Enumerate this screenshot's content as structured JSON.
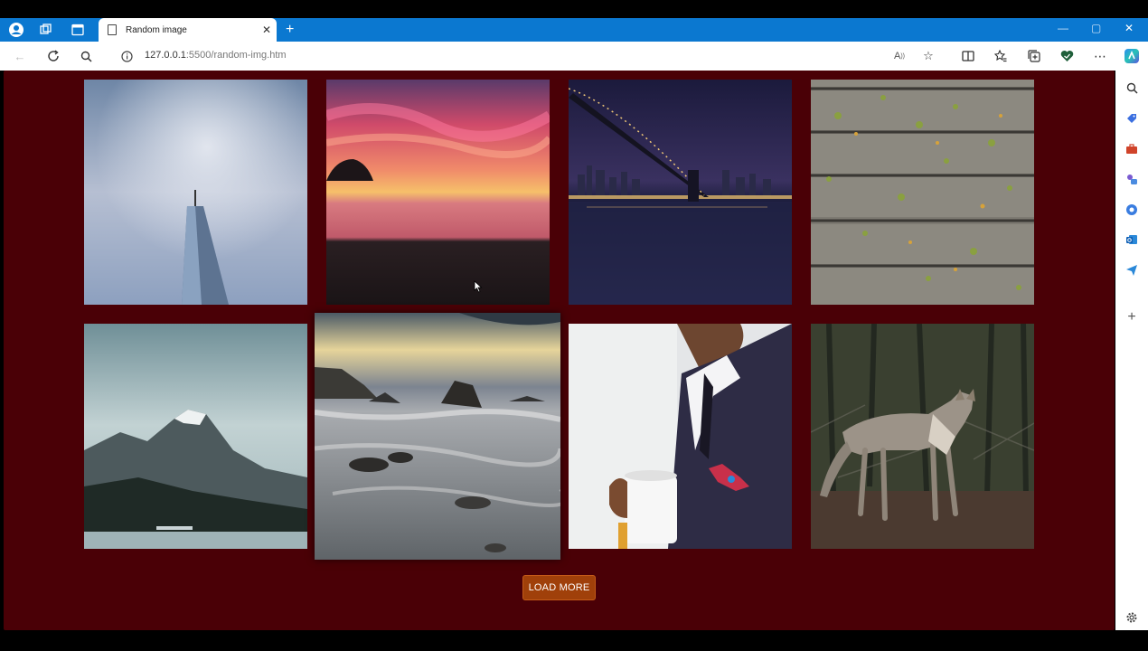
{
  "browser": {
    "tab": {
      "title": "Random image"
    },
    "address": {
      "host": "127.0.0.1",
      "rest": ":5500/random-img.htm"
    }
  },
  "gallery": {
    "images": [
      {
        "name": "skyscraper",
        "subject": "tall glass tower against cloudy sky"
      },
      {
        "name": "sunset-beach",
        "subject": "pink sunset over sea"
      },
      {
        "name": "bridge-night",
        "subject": "bridge and city lights at night"
      },
      {
        "name": "wood-planks",
        "subject": "wooden planks with leaves"
      },
      {
        "name": "mountain-lake",
        "subject": "snowy mountain over lake"
      },
      {
        "name": "rocky-shore",
        "subject": "rocks and waves on shore"
      },
      {
        "name": "man-coffee",
        "subject": "man in suit holding coffee cup"
      },
      {
        "name": "coyote",
        "subject": "coyote in forest"
      }
    ]
  },
  "load_more": {
    "label": "LOAD MORE"
  },
  "colors": {
    "page_bg": "#4a0006",
    "button_bg": "#a0400a",
    "tabbar": "#0b78d0"
  }
}
